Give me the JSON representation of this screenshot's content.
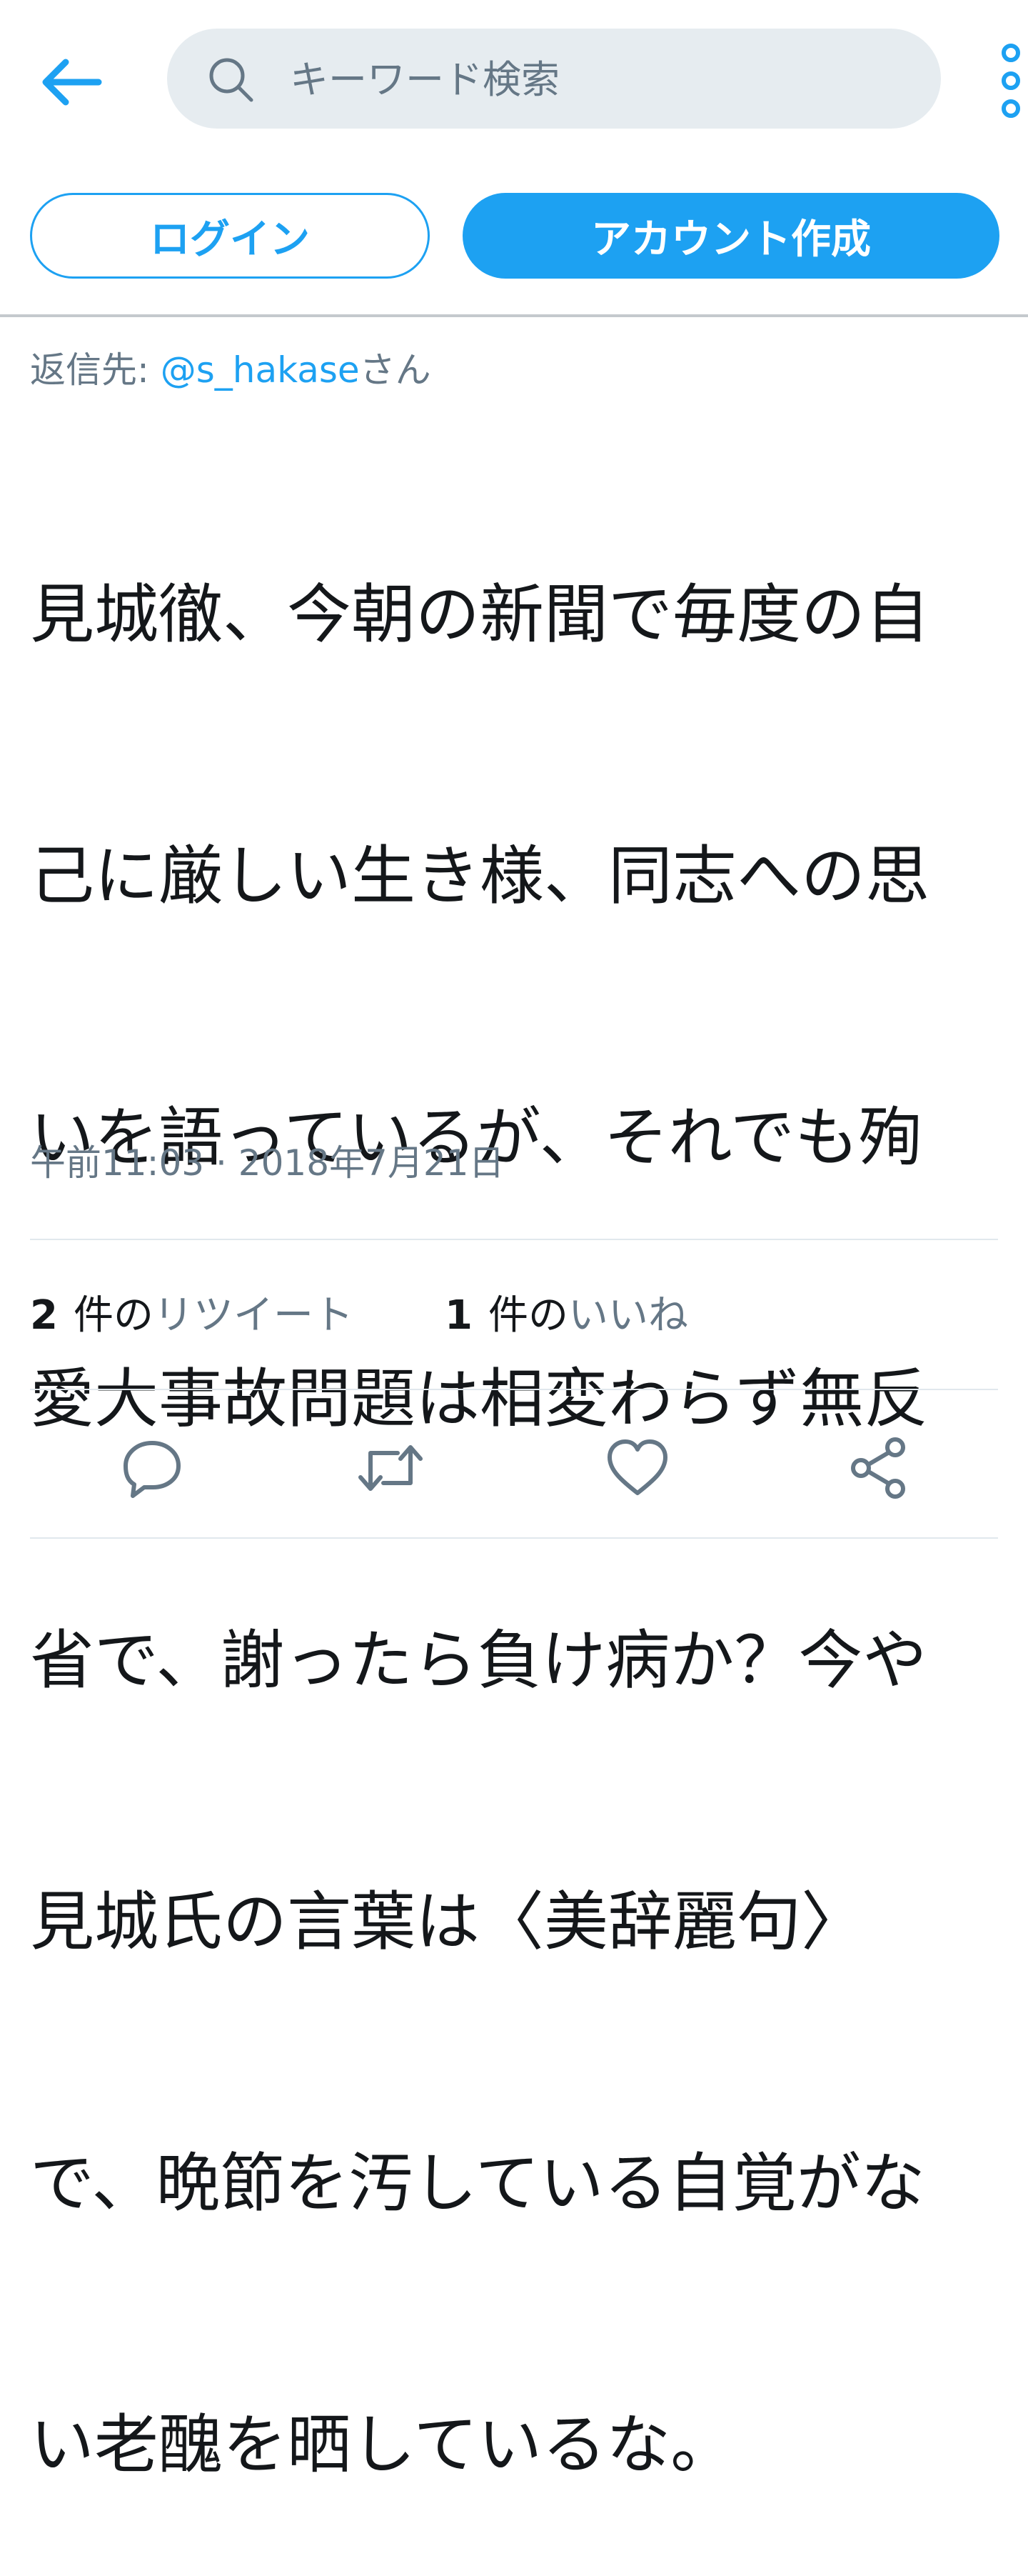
{
  "header": {
    "back_icon": "arrow-left-icon",
    "search": {
      "placeholder": "キーワード検索",
      "icon": "search-icon"
    },
    "more_icon": "more-vertical-icon"
  },
  "auth": {
    "login_label": "ログイン",
    "signup_label": "アカウント作成"
  },
  "tweet": {
    "reply_prefix": "返信先: ",
    "reply_handle": "@s_hakase",
    "reply_suffix": "さん",
    "lines": [
      "見城徹、今朝の新聞で毎度の自",
      "己に厳しい生き様、同志への思",
      "いを語っているが、それでも殉",
      "愛大事故問題は相変わらず無反",
      "省で、謝ったら負け病か？今や",
      "見城氏の言葉は〈美辞麗句〉",
      "で、晩節を汚している自覚がな",
      "い老醜を晒しているな。"
    ],
    "timestamp": "午前11:03 · 2018年7月21日",
    "retweets": {
      "count": "2",
      "unit": "件の",
      "label": "リツイート"
    },
    "likes": {
      "count": "1",
      "unit": "件の",
      "label": "いいね"
    }
  },
  "actions": [
    {
      "name": "reply",
      "icon": "reply-icon"
    },
    {
      "name": "retweet",
      "icon": "retweet-icon"
    },
    {
      "name": "like",
      "icon": "heart-icon"
    },
    {
      "name": "share",
      "icon": "share-icon"
    }
  ],
  "colors": {
    "accent": "#1da1f2",
    "text": "#14171a",
    "secondary_text": "#657786",
    "search_bg": "#e6ecf0",
    "divider": "#e1e8ed",
    "icon_gray": "#657786"
  }
}
